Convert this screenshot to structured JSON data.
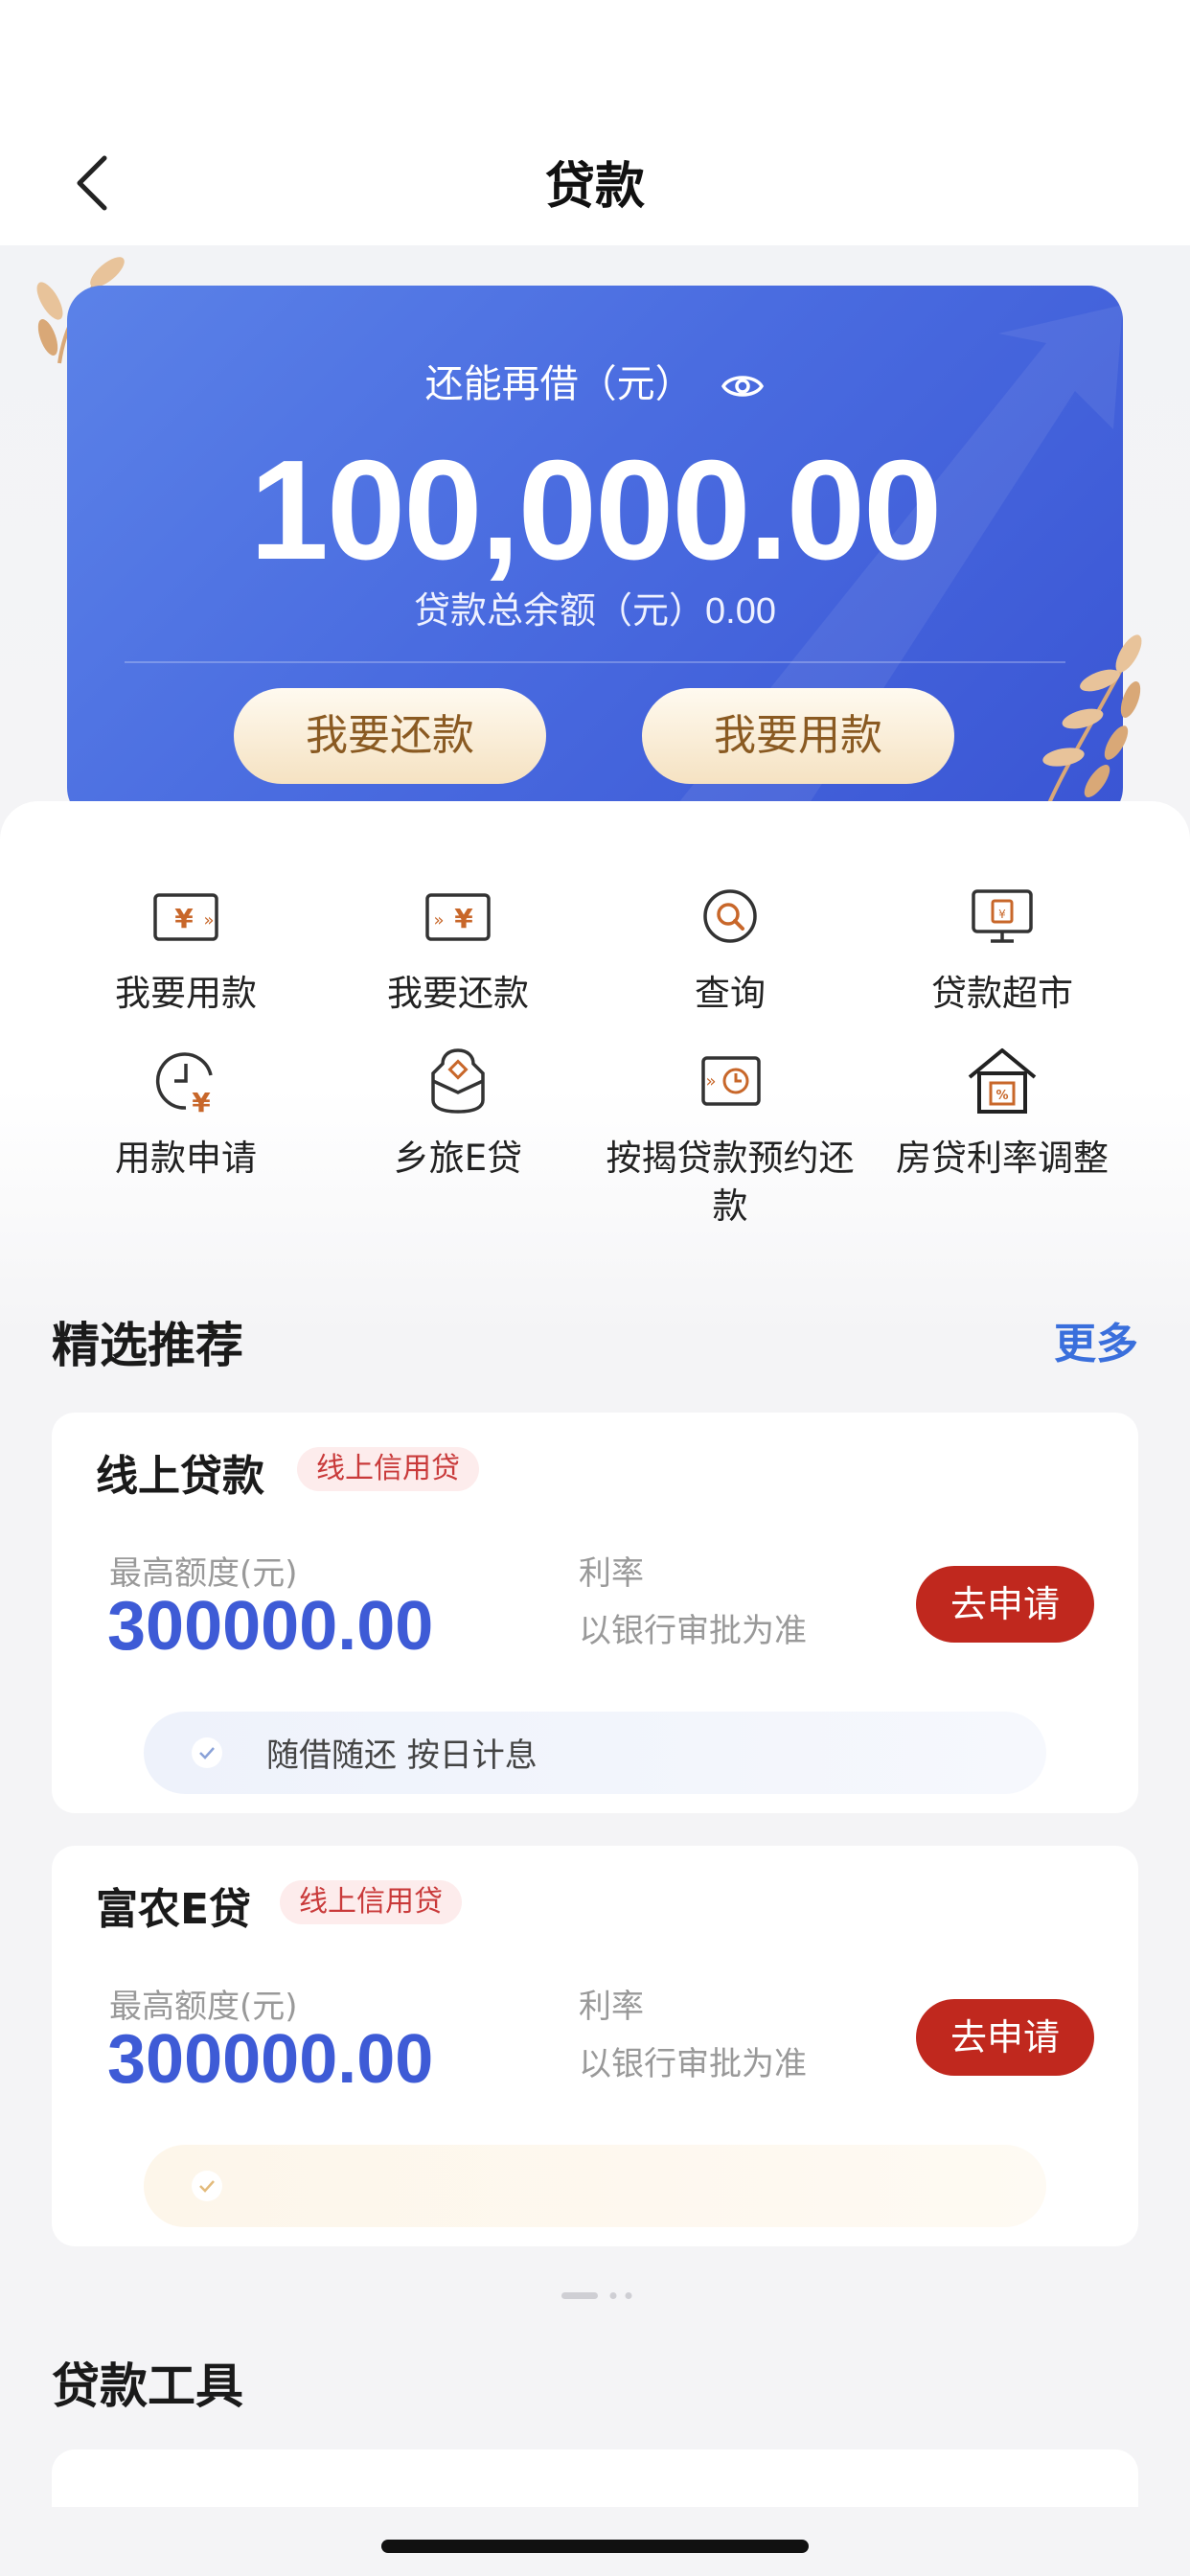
{
  "nav": {
    "title": "贷款"
  },
  "card": {
    "label": "还能再借（元）",
    "amount": "100,000.00",
    "sub_label": "贷款总余额（元）",
    "sub_value": "0.00",
    "btn_repay": "我要还款",
    "btn_use": "我要用款"
  },
  "grid": [
    {
      "label": "我要用款",
      "icon": "yen-out-icon"
    },
    {
      "label": "我要还款",
      "icon": "yen-in-icon"
    },
    {
      "label": "查询",
      "icon": "search-icon"
    },
    {
      "label": "贷款超市",
      "icon": "market-icon"
    },
    {
      "label": "用款申请",
      "icon": "clock-yen-icon"
    },
    {
      "label": "乡旅E贷",
      "icon": "travel-bag-icon"
    },
    {
      "label": "按揭贷款预约还款",
      "icon": "schedule-icon"
    },
    {
      "label": "房贷利率调整",
      "icon": "house-percent-icon"
    }
  ],
  "featured": {
    "title": "精选推荐",
    "more": "更多",
    "items": [
      {
        "name": "线上贷款",
        "tag": "线上信用贷",
        "limit_label": "最高额度(元)",
        "limit": "300000.00",
        "rate_label": "利率",
        "rate": "以银行审批为准",
        "apply": "去申请",
        "feature": "随借随还 按日计息"
      },
      {
        "name": "富农E贷",
        "tag": "线上信用贷",
        "limit_label": "最高额度(元)",
        "limit": "300000.00",
        "rate_label": "利率",
        "rate": "以银行审批为准",
        "apply": "去申请",
        "feature": ""
      }
    ]
  },
  "tools": {
    "title": "贷款工具"
  },
  "colors": {
    "card_blue": "#4a6ce0",
    "accent_red": "#c0281e",
    "link_blue": "#3a6fdc",
    "gold": "#8a5a22"
  }
}
